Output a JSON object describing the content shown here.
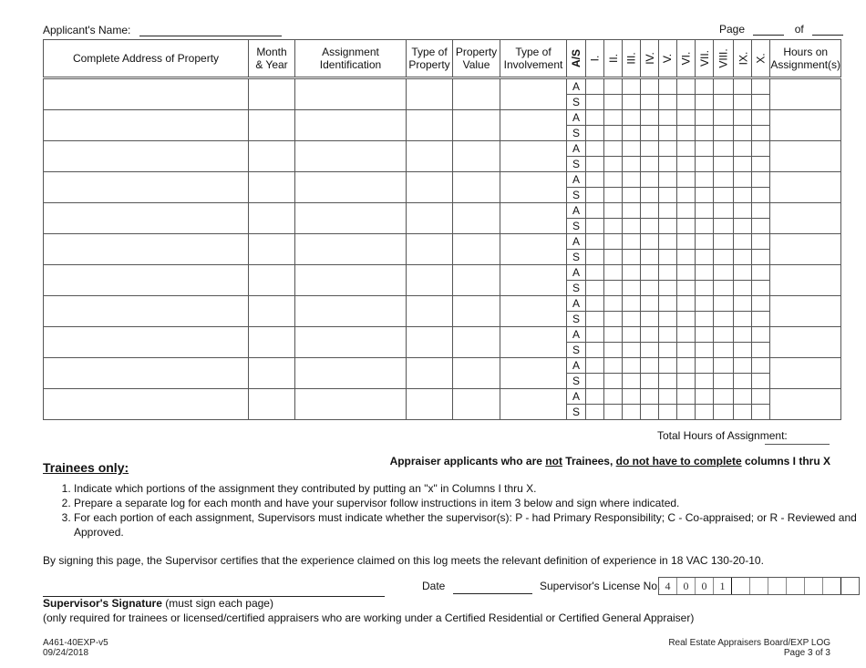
{
  "header": {
    "applicant_label": "Applicant's Name:",
    "applicant_value": "",
    "page_label": "Page",
    "page_value": "",
    "of_label": "of",
    "of_value": ""
  },
  "table": {
    "columns": [
      "Complete Address of Property",
      "Month\n& Year",
      "Assignment\nIdentification",
      "Type of\nProperty",
      "Property\nValue",
      "Type of\nInvolvement",
      "A/S",
      "I.",
      "II.",
      "III.",
      "IV.",
      "V.",
      "VI.",
      "VII.",
      "VIII.",
      "IX.",
      "X.",
      "Hours on\nAssignment(s)"
    ],
    "row_count": 11,
    "as_labels": [
      "A",
      "S"
    ]
  },
  "total_hours_label": "Total Hours of Assignment:",
  "total_hours_value": "",
  "trainees": {
    "heading": "Trainees only:",
    "notice_parts": [
      "Appraiser applicants who are ",
      "not",
      " Trainees, ",
      "do not have to complete",
      " columns I thru X"
    ],
    "instructions": [
      "Indicate which portions of the assignment they contributed by putting an \"x\" in Columns I thru X.",
      "Prepare a separate log for each month and have your supervisor follow instructions in item 3 below and sign where indicated.",
      "For each portion of each assignment, Supervisors must indicate whether the supervisor(s):  P - had Primary Responsibility;  C - Co-appraised; or R - Reviewed and Approved."
    ]
  },
  "certification": "By signing this page, the Supervisor certifies that the experience claimed on this log meets the relevant definition of experience in 18 VAC 130-20-10.",
  "signature": {
    "date_label": "Date",
    "date_value": "",
    "license_label": "Supervisor's License No.",
    "license_digits": [
      "4",
      "0",
      "0",
      "1",
      "",
      "",
      "",
      "",
      "",
      "",
      ""
    ],
    "signature_label_bold": "Supervisor's Signature",
    "signature_label_rest": " (must sign each page)",
    "signature_note": "(only required for trainees or licensed/certified appraisers who are working under a Certified Residential or Certified General Appraiser)"
  },
  "footer": {
    "form_id": "A461-40EXP-v5",
    "form_date": "09/24/2018",
    "board": "Real Estate Appraisers Board/EXP LOG",
    "page": "Page 3 of 3"
  }
}
